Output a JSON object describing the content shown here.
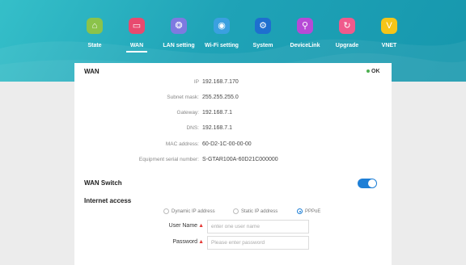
{
  "nav": {
    "items": [
      {
        "label": "State",
        "icon": "home-icon",
        "color": "#8bc34a",
        "glyph": "⌂"
      },
      {
        "label": "WAN",
        "icon": "monitor-icon",
        "color": "#e84a6f",
        "glyph": "▭"
      },
      {
        "label": "LAN setting",
        "icon": "network-icon",
        "color": "#7e7ae0",
        "glyph": "❂"
      },
      {
        "label": "Wi-Fi setting",
        "icon": "wifi-icon",
        "color": "#3aa0e0",
        "glyph": "◉"
      },
      {
        "label": "System",
        "icon": "system-gear-icon",
        "color": "#1e6fcf",
        "glyph": "⚙"
      },
      {
        "label": "DeviceLink",
        "icon": "link-icon",
        "color": "#b64ad6",
        "glyph": "⚲"
      },
      {
        "label": "Upgrade",
        "icon": "refresh-icon",
        "color": "#f05a8c",
        "glyph": "↻"
      },
      {
        "label": "VNET",
        "icon": "vnet-icon",
        "color": "#f5c518",
        "glyph": "V"
      }
    ],
    "active": "WAN"
  },
  "wan": {
    "title": "WAN",
    "status": "OK",
    "status_color": "#4caf50",
    "info": [
      {
        "label": "IP",
        "value": "192.168.7.170"
      },
      {
        "label": "Subnet mask:",
        "value": "255.255.255.0"
      },
      {
        "label": "Gateway:",
        "value": "192.168.7.1"
      },
      {
        "label": "DNS:",
        "value": "192.168.7.1"
      },
      {
        "label": "MAC address:",
        "value": "60-D2-1C-00-00-00"
      },
      {
        "label": "Equipment serial number:",
        "value": "S-GTAR100A-60D21C000000"
      }
    ]
  },
  "wan_switch": {
    "label": "WAN Switch",
    "enabled": true,
    "accent": "#1e7fd6"
  },
  "internet_access": {
    "label": "Internet access",
    "options": [
      "Dynamic IP address",
      "Static IP address",
      "PPPoE"
    ],
    "selected": "PPPoE"
  },
  "form": {
    "username": {
      "label": "User Name",
      "placeholder": "enter one user name",
      "value": ""
    },
    "password": {
      "label": "Password",
      "placeholder": "Please enter password",
      "value": ""
    }
  }
}
